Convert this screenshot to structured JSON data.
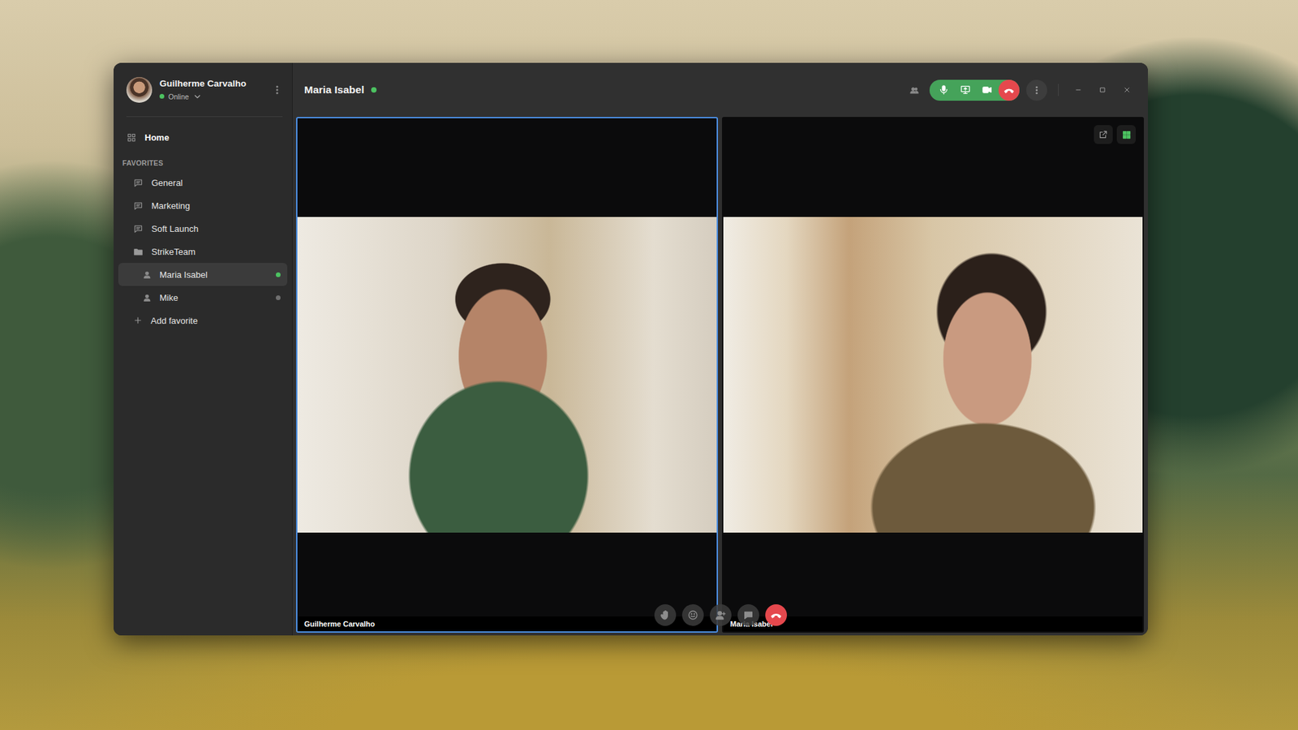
{
  "user": {
    "name": "Guilherme Carvalho",
    "status": "Online",
    "online": true
  },
  "sidebar": {
    "home": {
      "label": "Home",
      "selected": false
    },
    "section": "FAVORITES",
    "items": [
      {
        "label": "General",
        "kind": "channel",
        "selected": false
      },
      {
        "label": "Marketing",
        "kind": "channel",
        "selected": false
      },
      {
        "label": "Soft Launch",
        "kind": "channel",
        "selected": false
      },
      {
        "label": "StrikeTeam",
        "kind": "folder",
        "selected": false,
        "expanded": true,
        "members": [
          {
            "label": "Maria Isabel",
            "selected": true,
            "online": true
          },
          {
            "label": "Mike",
            "selected": false,
            "online": false
          }
        ]
      }
    ],
    "add": "Add favorite"
  },
  "call": {
    "title": "Maria Isabel",
    "online": true,
    "mic_on": true,
    "camera_on": true,
    "layout_grid": true,
    "tiles": [
      {
        "name": "Guilherme Carvalho",
        "selected": true
      },
      {
        "name": "Maria Isabel",
        "selected": false
      }
    ]
  }
}
